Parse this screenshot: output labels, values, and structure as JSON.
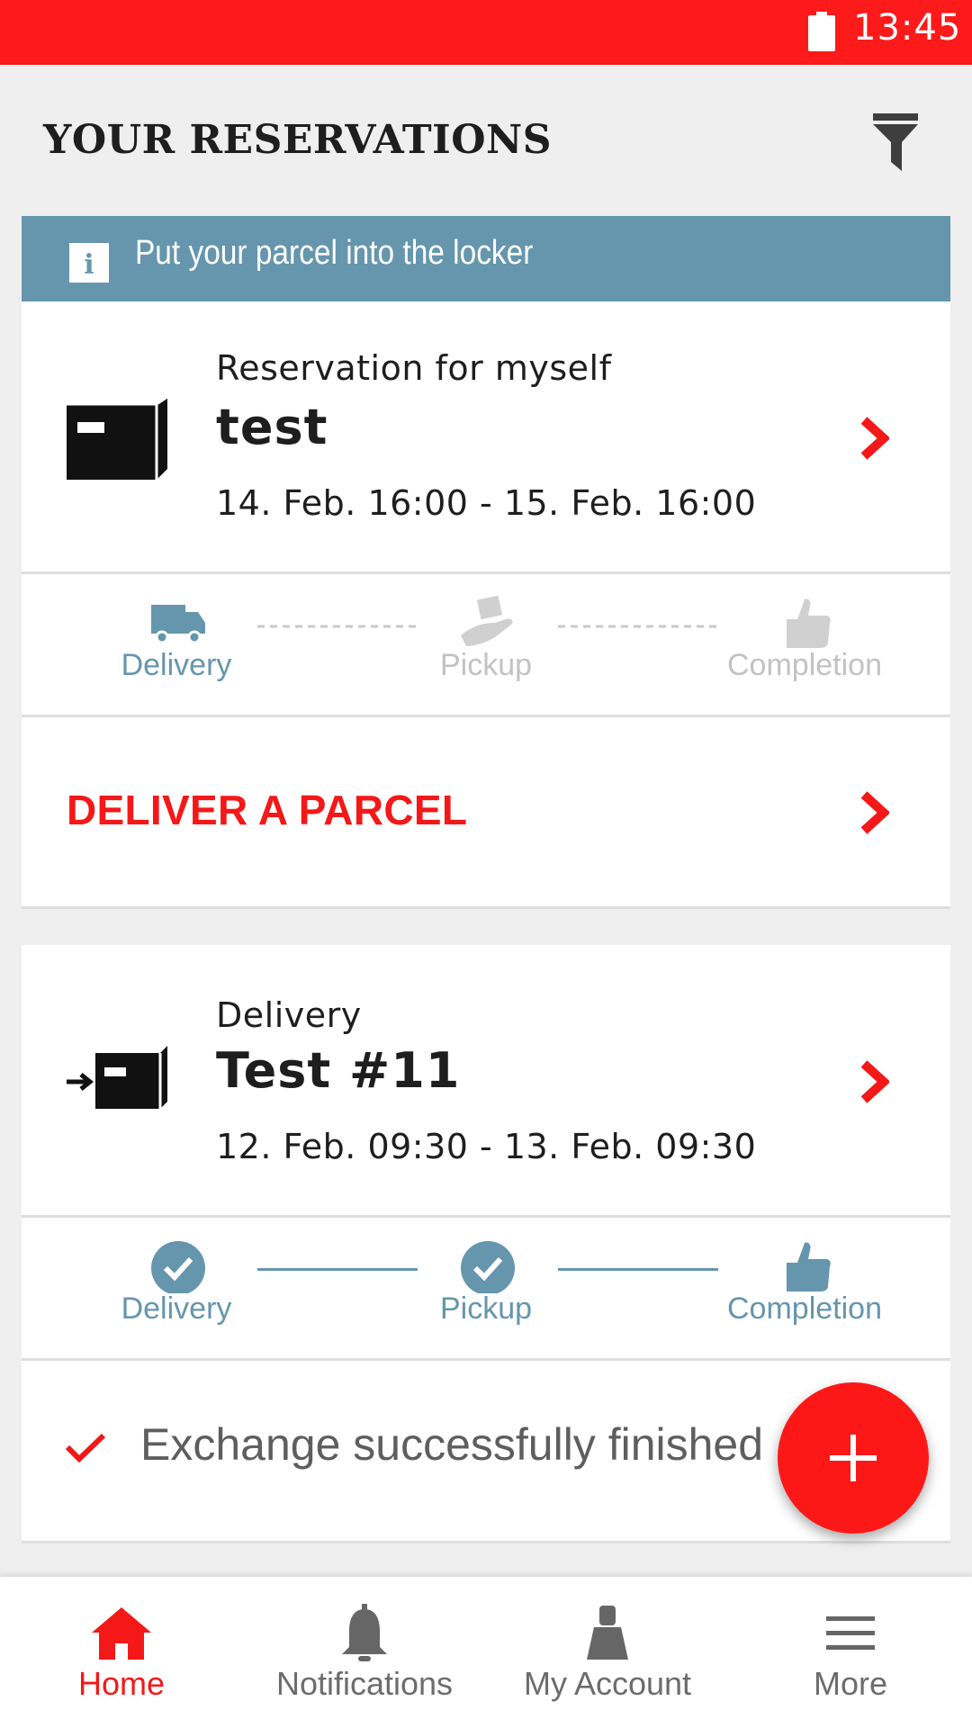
{
  "status_bar": {
    "time": "13:45"
  },
  "header": {
    "title": "YOUR RESERVATIONS"
  },
  "banner": {
    "text": "Put your parcel into the locker"
  },
  "reservations": [
    {
      "subtitle": "Reservation for myself",
      "name": "test",
      "dates": "14. Feb. 16:00 - 15. Feb. 16:00",
      "steps": [
        {
          "label": "Delivery",
          "state": "active"
        },
        {
          "label": "Pickup",
          "state": "pending"
        },
        {
          "label": "Completion",
          "state": "pending"
        }
      ],
      "action_label": "DELIVER A PARCEL"
    },
    {
      "subtitle": "Delivery",
      "name": "Test #11",
      "dates": "12. Feb. 09:30 - 13. Feb. 09:30",
      "steps": [
        {
          "label": "Delivery",
          "state": "done"
        },
        {
          "label": "Pickup",
          "state": "done"
        },
        {
          "label": "Completion",
          "state": "done"
        }
      ],
      "status_text": "Exchange successfully finished"
    }
  ],
  "bottom_nav": [
    {
      "label": "Home",
      "icon": "home-icon",
      "active": true
    },
    {
      "label": "Notifications",
      "icon": "bell-icon",
      "active": false
    },
    {
      "label": "My Account",
      "icon": "account-icon",
      "active": false
    },
    {
      "label": "More",
      "icon": "menu-icon",
      "active": false
    }
  ],
  "colors": {
    "brand_red": "#fd1a1a",
    "banner_blue": "#6596ad",
    "step_active": "#6596ad",
    "step_pending": "#c9c9c9"
  }
}
